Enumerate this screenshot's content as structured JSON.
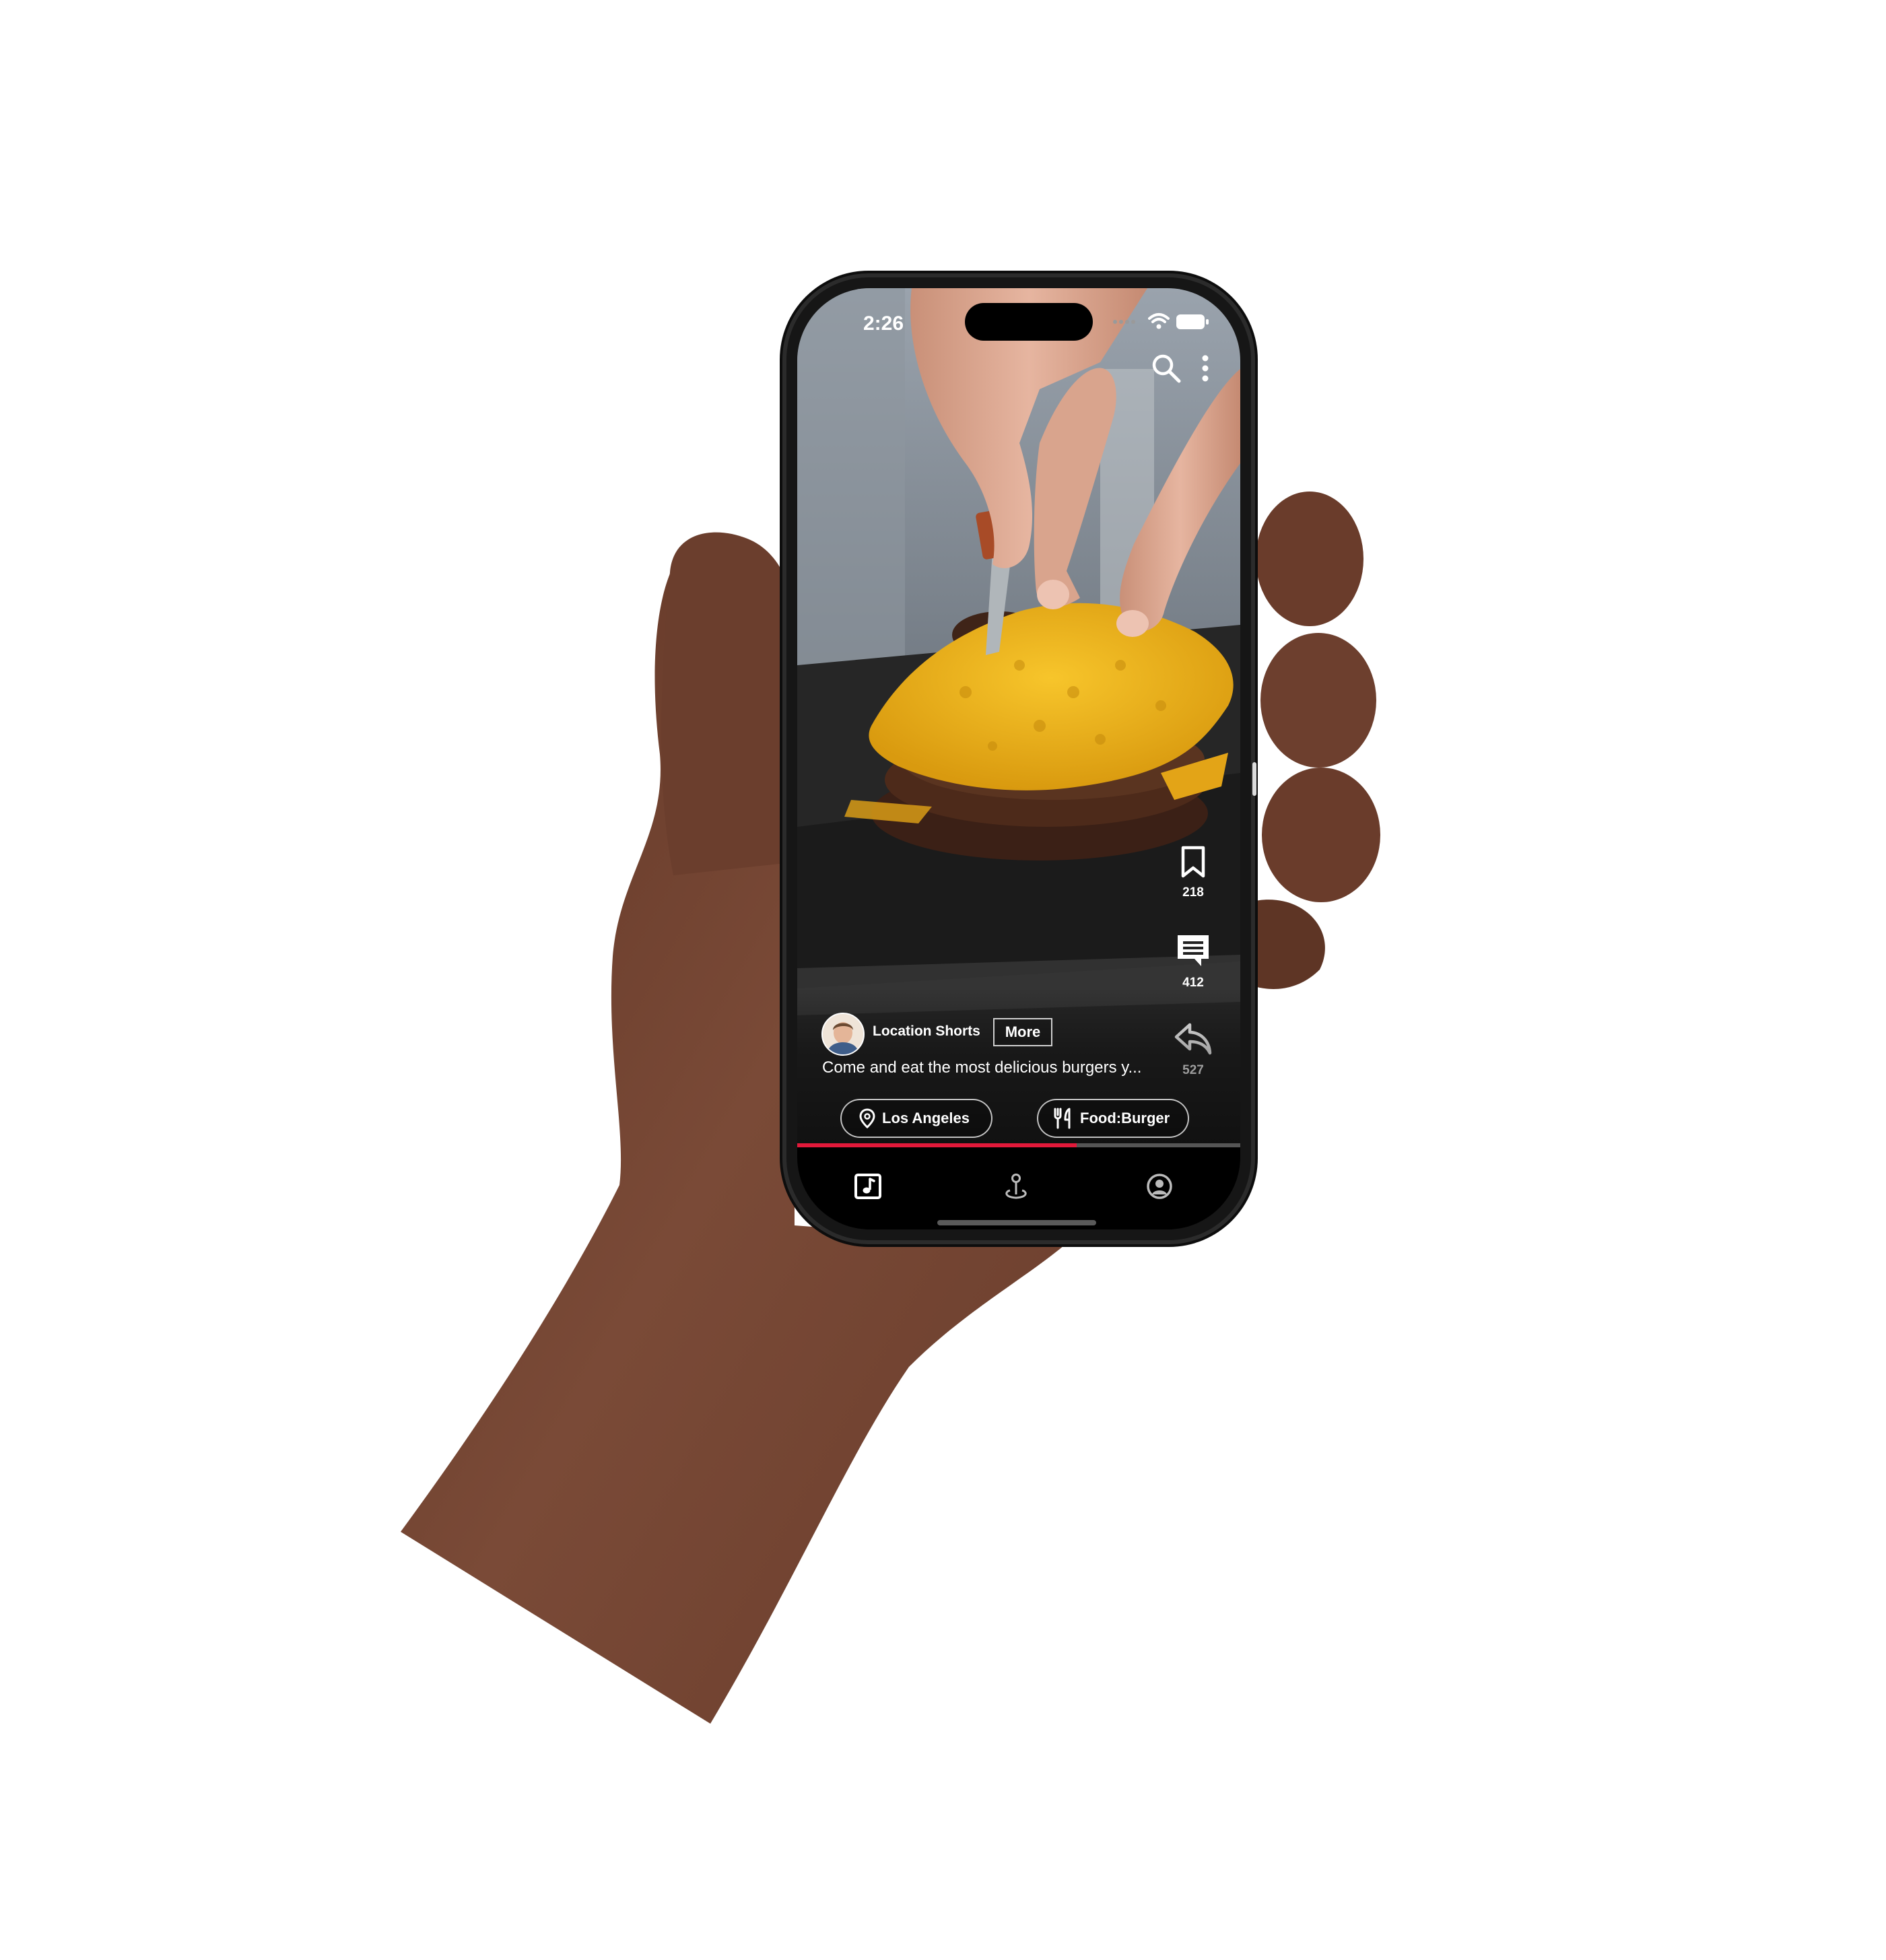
{
  "status_bar": {
    "time": "2:26"
  },
  "feed": {
    "actions": [
      {
        "name": "bookmark",
        "icon": "bookmark-icon",
        "count": "218"
      },
      {
        "name": "comment",
        "icon": "comment-icon",
        "count": "412"
      },
      {
        "name": "share",
        "icon": "share-icon",
        "count": "527"
      }
    ],
    "channel": {
      "name": "Location Shorts",
      "more_label": "More"
    },
    "description": "Come and eat the most delicious burgers y...",
    "chips": [
      {
        "icon": "location-pin-icon",
        "label": "Los Angeles"
      },
      {
        "icon": "fork-knife-icon",
        "label": "Food:Burger"
      }
    ],
    "progress": 0.63
  },
  "top_bar": {
    "icons": [
      "search-icon",
      "more-vertical-icon"
    ]
  },
  "tabbar": {
    "icons": [
      "music-shorts-icon",
      "map-pin-icon",
      "profile-icon"
    ],
    "active": 0
  },
  "colors": {
    "accent": "#e2193a",
    "skin": "#7a4a37",
    "cheese": "#f2b51c"
  }
}
